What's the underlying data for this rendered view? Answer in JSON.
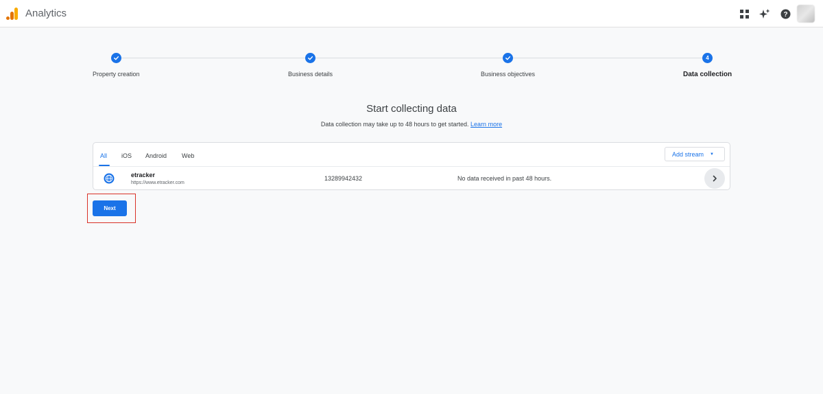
{
  "header": {
    "app_title": "Analytics",
    "icons": [
      "apps-grid-icon",
      "sparkle-icon",
      "help-icon"
    ]
  },
  "stepper": {
    "steps": [
      {
        "label": "Property creation",
        "status": "completed"
      },
      {
        "label": "Business details",
        "status": "completed"
      },
      {
        "label": "Business objectives",
        "status": "completed"
      },
      {
        "label": "Data collection",
        "status": "active",
        "number": "4"
      }
    ]
  },
  "main": {
    "heading": "Start collecting data",
    "subheading": "Data collection may take up to 48 hours to get started.",
    "learn_more": "Learn more"
  },
  "streams": {
    "tabs": [
      {
        "label": "All",
        "active": true
      },
      {
        "label": "iOS",
        "active": false
      },
      {
        "label": "Android",
        "active": false
      },
      {
        "label": "Web",
        "active": false
      }
    ],
    "add_stream_label": "Add stream",
    "rows": [
      {
        "icon": "globe-icon",
        "name": "etracker",
        "url": "https://www.etracker.com",
        "id": "13289942432",
        "status": "No data received in past 48 hours."
      }
    ]
  },
  "actions": {
    "next_label": "Next"
  },
  "colors": {
    "accent": "#1a73e8",
    "highlight": "#d93025",
    "background": "#f8f9fa"
  }
}
